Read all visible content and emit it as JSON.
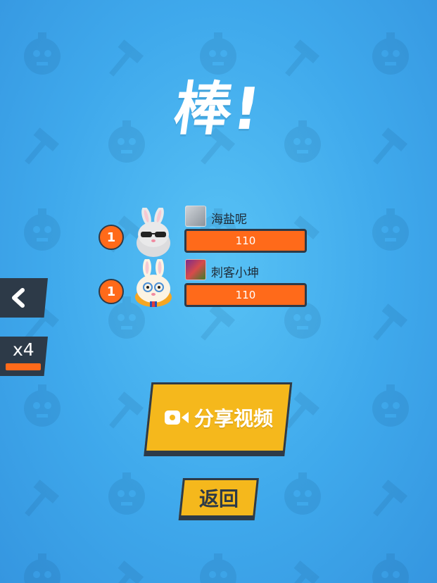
{
  "title": "棒!",
  "players": [
    {
      "rank": "1",
      "name": "海盐呢",
      "score": "110"
    },
    {
      "rank": "1",
      "name": "刺客小坤",
      "score": "110"
    }
  ],
  "side": {
    "multiplier": "x4"
  },
  "buttons": {
    "share_label": "分享视频",
    "return_label": "返回"
  },
  "colors": {
    "background": "#45b1ee",
    "accent": "#ff6a1a",
    "button": "#f5b81c",
    "dark": "#2d3a48"
  },
  "icons": {
    "back": "chevron-left-icon",
    "share": "video-camera-icon",
    "pattern": "bomb-hammer-pattern"
  }
}
